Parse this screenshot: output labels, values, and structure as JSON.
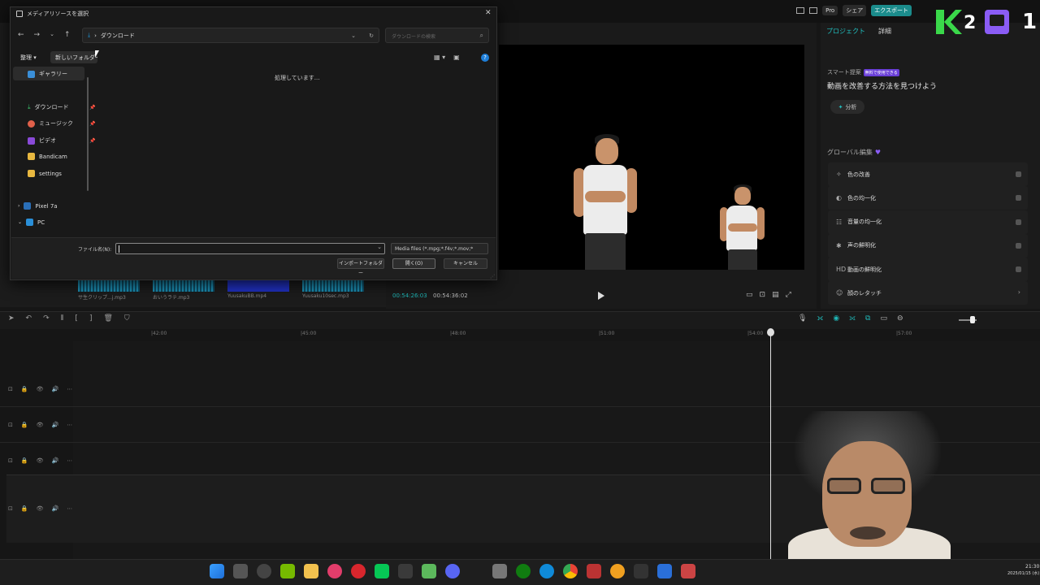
{
  "editor": {
    "topbar": {
      "pro": "Pro",
      "share": "シェア",
      "export": "エクスポート"
    },
    "media_files": [
      "サ生クリップ...j.mp3",
      "おいうラテ.mp3",
      "YuusakuBB.mp4",
      "Yuusaku10sec.mp3"
    ],
    "player": {
      "timecode_current": "00:54:26:03",
      "timecode_total": "00:54:36:02"
    },
    "right_panel": {
      "tabs": [
        "プロジェクト",
        "詳細"
      ],
      "smart_label": "スマート提案",
      "smart_badge": "無料で使用できる",
      "smart_title": "動画を改善する方法を見つけよう",
      "analyze_label": "分析",
      "global_label": "グローバル編集",
      "items": [
        {
          "label": "色の改善",
          "icon": "sparkle-icon"
        },
        {
          "label": "色の均一化",
          "icon": "color-match-icon"
        },
        {
          "label": "音量の均一化",
          "icon": "volume-icon"
        },
        {
          "label": "声の鮮明化",
          "icon": "voice-icon"
        },
        {
          "label": "動画の鮮明化",
          "icon": "hd-icon"
        },
        {
          "label": "顔のレタッチ",
          "icon": "face-icon"
        }
      ]
    },
    "timeline": {
      "ruler_labels": [
        "|42:00",
        "|45:00",
        "|48:00",
        "|51:00",
        "|54:00",
        "|57:00"
      ]
    }
  },
  "overlay": {
    "k_number": "2",
    "right_number": "1"
  },
  "taskbar": {
    "time": "21:30",
    "date": "2025/01/15 (水)"
  },
  "dialog": {
    "title": "メディアリソースを選択",
    "address": "ダウンロード",
    "search_placeholder": "ダウンロードの検索",
    "organize": "整理",
    "new_folder": "新しいフォルダー",
    "processing": "処理しています...",
    "nav": {
      "gallery": "ギャラリー",
      "downloads": "ダウンロード",
      "music": "ミュージック",
      "video": "ビデオ",
      "bandicam": "Bandicam",
      "settings": "settings",
      "pixel": "Pixel 7a",
      "pc": "PC"
    },
    "filename_label": "ファイル名(N):",
    "filename_value": "",
    "filter": "Media files (*.mpg;*.f4v;*.mov;*",
    "import_folder": "インポートフォルダー",
    "open": "開く(O)",
    "cancel": "キャンセル"
  },
  "colors": {
    "accent": "#1fb5b5",
    "dialog_bg": "#191919",
    "help_blue": "#1e7ed8",
    "twitch": "#8a5cf5",
    "k_green": "#3ad84a"
  }
}
